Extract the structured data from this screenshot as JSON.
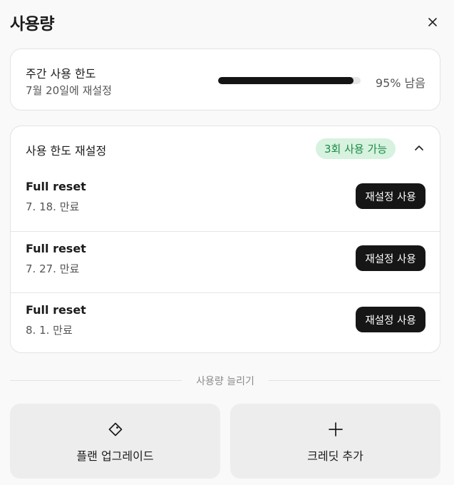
{
  "dialog": {
    "title": "사용량"
  },
  "weekly": {
    "title": "주간 사용 한도",
    "reset_text": "7월 20일에 재설정",
    "remaining_fraction": 0.95,
    "remaining_text": "95% 남음"
  },
  "reset_section": {
    "title": "사용 한도 재설정",
    "badge": "3회 사용 가능",
    "items": [
      {
        "title": "Full reset",
        "expiry": "7. 18. 만료",
        "button": "재설정 사용"
      },
      {
        "title": "Full reset",
        "expiry": "7. 27. 만료",
        "button": "재설정 사용"
      },
      {
        "title": "Full reset",
        "expiry": "8. 1. 만료",
        "button": "재설정 사용"
      }
    ]
  },
  "increase": {
    "label": "사용량 늘리기",
    "actions": [
      {
        "label": "플랜 업그레이드",
        "icon": "diamond-tag-icon"
      },
      {
        "label": "크레딧 추가",
        "icon": "plus-icon"
      }
    ]
  },
  "colors": {
    "badge_bg": "#d7f2df",
    "badge_text": "#1d8a47",
    "button_bg": "#161616",
    "progress_fill": "#141414"
  }
}
